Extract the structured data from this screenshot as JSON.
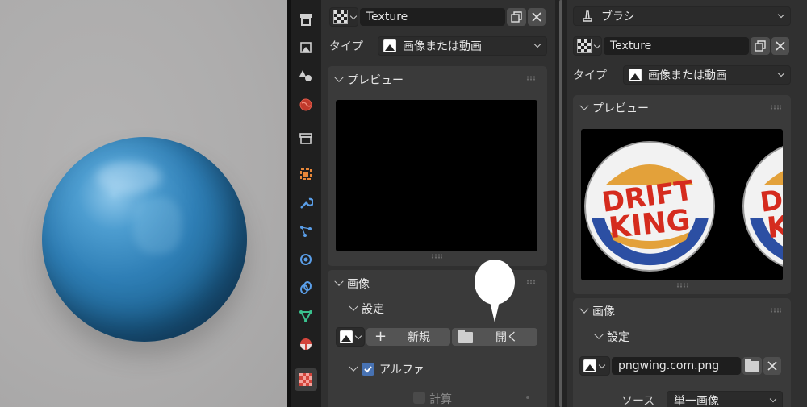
{
  "left_panel": {
    "texture_name": "Texture",
    "type_label": "タイプ",
    "type_value": "画像または動画",
    "preview_header": "プレビュー",
    "image_header": "画像",
    "settings_header": "設定",
    "new_button": "新規",
    "open_button": "開く",
    "alpha_label": "アルファ",
    "calc_label": "計算"
  },
  "right_panel": {
    "brush_label": "ブラシ",
    "texture_name": "Texture",
    "type_label": "タイプ",
    "type_value": "画像または動画",
    "preview_header": "プレビュー",
    "preview_logo_line1": "DRIFT",
    "preview_logo_line2": "KING",
    "image_header": "画像",
    "settings_header": "設定",
    "image_file": "pngwing.com.png",
    "source_label": "ソース",
    "source_value": "単一画像"
  },
  "tabs": [
    "tool-tab",
    "render-tab",
    "output-tab",
    "view-layer-tab",
    "scene-tab",
    "world-tab",
    "collection-tab",
    "object-tab",
    "modifier-tab",
    "particles-tab",
    "physics-tab",
    "constraints-tab",
    "data-tab",
    "material-tab",
    "texture-tab"
  ],
  "colors": {
    "accent": "#4772b3",
    "panel": "#303030",
    "box": "#3a3a3a",
    "checkbox": "#4772b3"
  }
}
